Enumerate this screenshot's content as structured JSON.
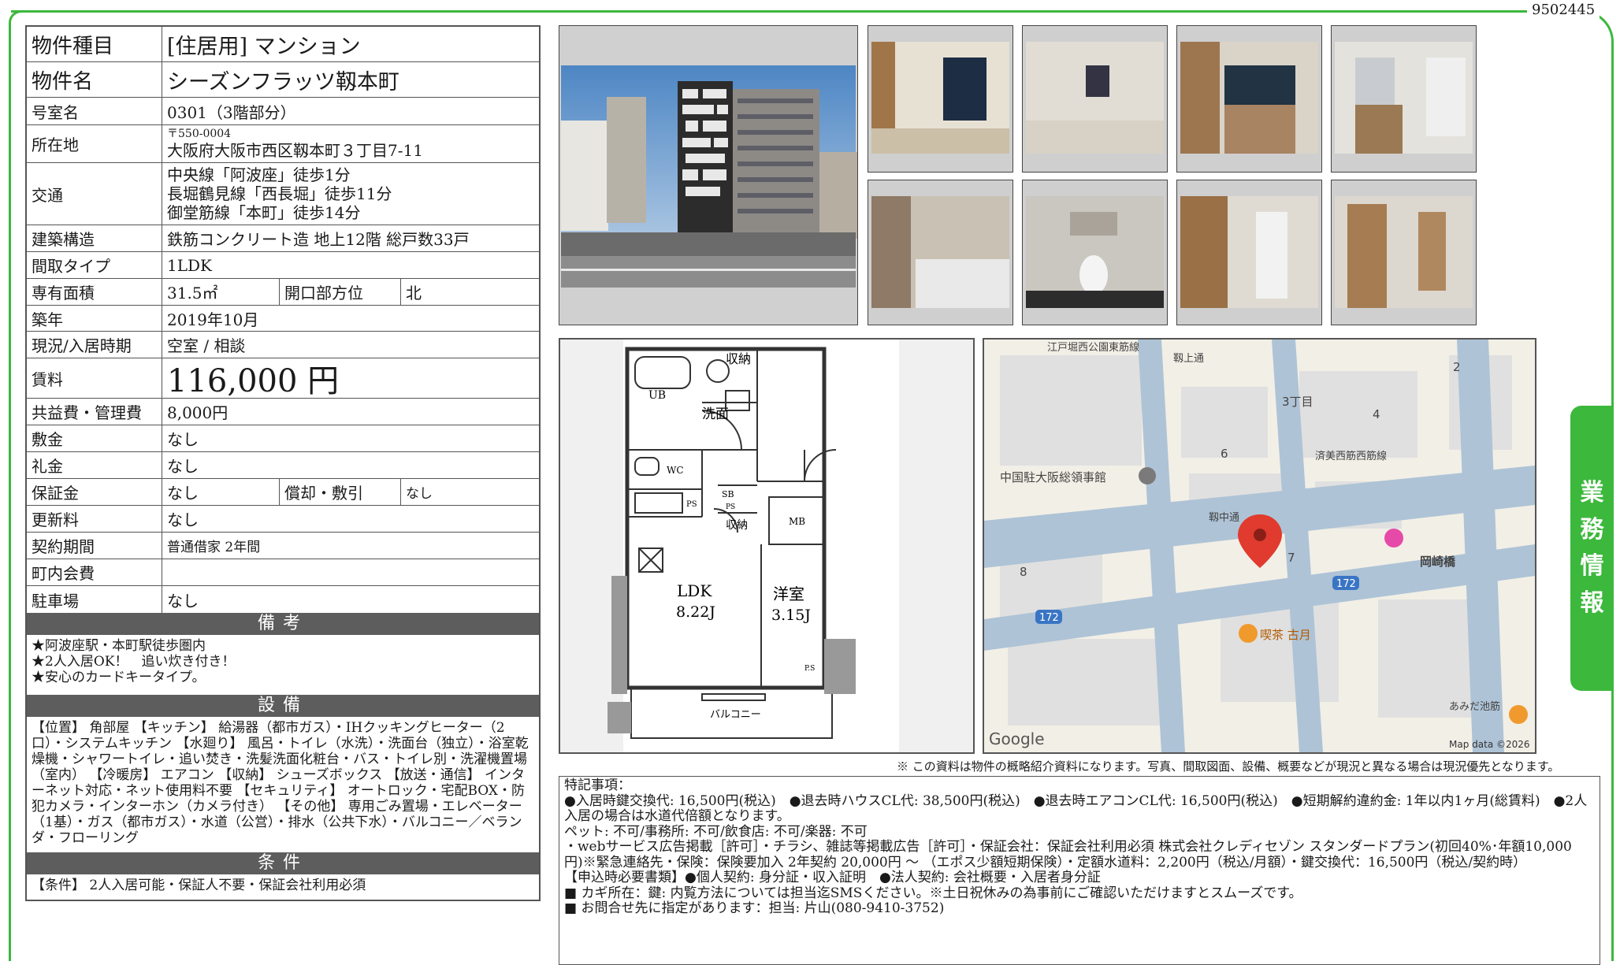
{
  "property_id": "9502445",
  "side_tab": [
    "業",
    "務",
    "情",
    "報"
  ],
  "spec": {
    "type_label": "物件種目",
    "type_value": "[住居用]  マンション",
    "name_label": "物件名",
    "name_value": "シーズンフラッツ靱本町",
    "room_label": "号室名",
    "room_value": "0301（3階部分）",
    "address_label": "所在地",
    "address_zip": "〒550-0004",
    "address_value": "大阪府大阪市西区靱本町３丁目7-11",
    "access_label": "交通",
    "access_lines": [
      "中央線「阿波座」徒歩1分",
      "長堀鶴見線「西長堀」徒歩11分",
      "御堂筋線「本町」徒歩14分"
    ],
    "structure_label": "建築構造",
    "structure_value": "鉄筋コンクリート造 地上12階 総戸数33戸",
    "layout_label": "間取タイプ",
    "layout_value": "1LDK",
    "area_label": "専有面積",
    "area_value": "31.5㎡",
    "opening_label": "開口部方位",
    "opening_value": "北",
    "built_label": "築年",
    "built_value": "2019年10月",
    "status_label": "現況/入居時期",
    "status_value": "空室 / 相談",
    "rent_label": "賃料",
    "rent_value": "116,000 円",
    "fee_label": "共益費・管理費",
    "fee_value": "8,000円",
    "deposit_label": "敷金",
    "deposit_value": "なし",
    "key_money_label": "礼金",
    "key_money_value": "なし",
    "guarantee_label": "保証金",
    "guarantee_value": "なし",
    "amort_label": "償却・敷引",
    "amort_value": "なし",
    "renewal_label": "更新料",
    "renewal_value": "なし",
    "contract_label": "契約期間",
    "contract_value": "普通借家 2年間",
    "town_label": "町内会費",
    "town_value": "",
    "parking_label": "駐車場",
    "parking_value": "なし"
  },
  "remarks": {
    "header": "備考",
    "lines": [
      "★阿波座駅・本町駅徒歩圏内",
      "★2人入居OK！　追い炊き付き！",
      "★安心のカードキータイプ。"
    ]
  },
  "equipment": {
    "header": "設備",
    "text": "【位置】 角部屋 【キッチン】 給湯器（都市ガス）・IHクッキングヒーター（2口）・システムキッチン 【水廻り】 風呂・トイレ（水洗）・洗面台（独立）・浴室乾燥機・シャワートイレ・追い焚き・洗髪洗面化粧台・バス・トイレ別・洗濯機置場（室内） 【冷暖房】 エアコン 【収納】 シューズボックス 【放送・通信】 インターネット対応・ネット使用料不要 【セキュリティ】 オートロック・宅配BOX・防犯カメラ・インターホン（カメラ付き） 【その他】 専用ごみ置場・エレベーター（1基）・ガス（都市ガス）・水道（公営）・排水（公共下水）・バルコニー／ベランダ・フローリング"
  },
  "conditions": {
    "header": "条件",
    "text": "【条件】 2人入居可能・保証人不要・保証会社利用必須"
  },
  "floorplan": {
    "storage1": "収納",
    "ub": "UB",
    "washroom": "洗面",
    "wc": "WC",
    "sb": "SB",
    "ps": "PS",
    "ps2": "PS",
    "storage2": "収納",
    "mb": "MB",
    "ldk": "LDK",
    "ldk_size": "8.22J",
    "western": "洋室",
    "western_size": "3.15J",
    "ps3": "P.S",
    "balcony": "バルコニー"
  },
  "map": {
    "labels": {
      "street1": "江戸堀西公園東筋線",
      "street2": "靱上通",
      "street3": "靱中通",
      "street4": "済美西筋西筋線",
      "chome": "3丁目",
      "consulate": "中国駐大阪総領事館",
      "bridge": "岡崎橋",
      "cafe": "喫茶 古月",
      "river": "あみだ池筋",
      "n2": "2",
      "n4": "4",
      "n6": "6",
      "n7": "7",
      "n8": "8",
      "route1": "172",
      "route2": "172",
      "google": "Google",
      "mapdata": "Map data ©2026"
    },
    "colors": {
      "road": "#aec3d6",
      "block": "#f0ede4",
      "building": "#dcdcdc",
      "pin": "#e03b2e"
    }
  },
  "disclaimer": "※ この資料は物件の概略紹介資料になります。写真、間取図面、設備、概要などが現況と異なる場合は現況優先となります。",
  "notes": [
    "特記事項：",
    "●入居時鍵交換代: 16,500円(税込)　●退去時ハウスCL代: 38,500円(税込)　●退去時エアコンCL代: 16,500円(税込)　●短期解約違約金: 1年以内1ヶ月(総賃料)　●2人入居の場合は水道代倍額となります。",
    "ペット: 不可/事務所: 不可/飲食店: 不可/楽器: 不可",
    "・webサービス広告掲載［許可］・チラシ、雑誌等掲載広告［許可］・保証会社：保証会社利用必須 株式会社クレディセゾン スタンダードプラン(初回40%･年額10,000円)※緊急連絡先・保険：保険要加入 2年契約 20,000円 ～ （エポス少額短期保険）・定額水道料：2,200円（税込/月額）・鍵交換代：16,500円（税込/契約時）",
    "【申込時必要書類】●個人契約: 身分証・収入証明　●法人契約: 会社概要・入居者身分証",
    "■ カギ所在：鍵: 内覧方法については担当迄SMSください。※土日祝休みの為事前にご確認いただけますとスムーズです。",
    "■ お問合せ先に指定があります：担当: 片山(080-9410-3752)"
  ]
}
